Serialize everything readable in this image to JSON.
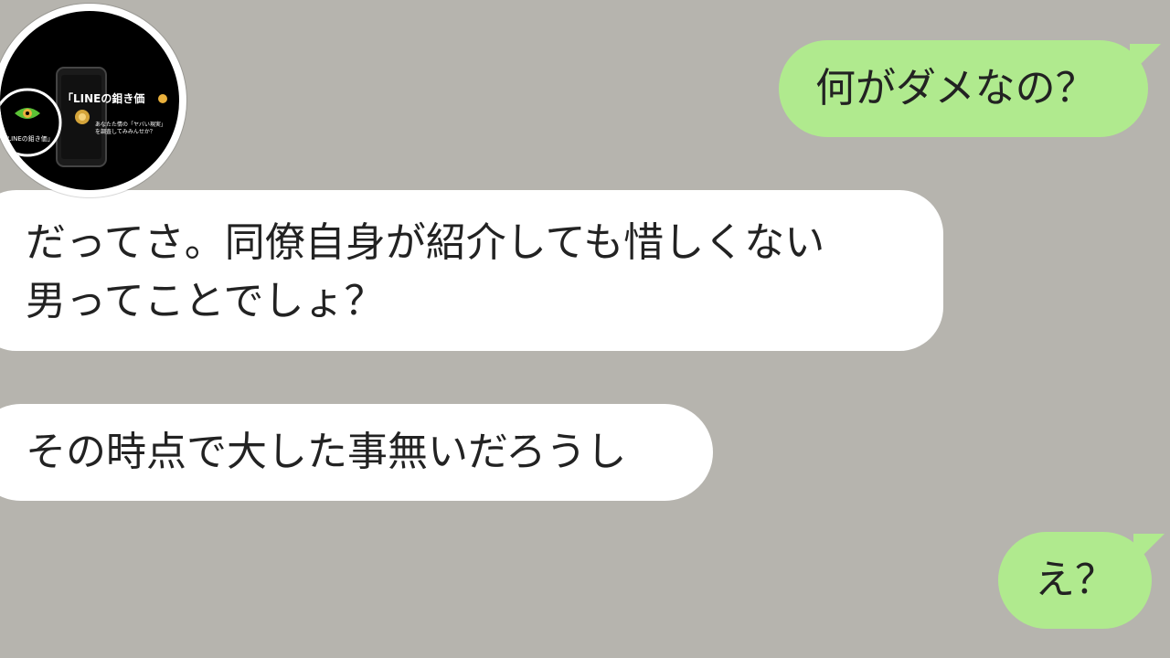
{
  "messages": [
    {
      "side": "right",
      "lines": [
        "何がダメなの？"
      ]
    },
    {
      "side": "left",
      "lines": [
        "だってさ。同僚自身が紹介しても惜しくない",
        "男ってことでしょ？"
      ]
    },
    {
      "side": "left",
      "lines": [
        "その時点で大した事無いだろうし"
      ]
    },
    {
      "side": "right",
      "lines": [
        "え？"
      ]
    }
  ],
  "logo": {
    "title": "「LINEの鉬き価",
    "small_label": "「LINEの鉬き価」",
    "tagline_line1": "あなたた情の「ヤバい現実」",
    "tagline_line2": "を調査してみみんせか？"
  },
  "colors": {
    "background": "#b6b4ae",
    "sent_bubble": "#b0ea8e",
    "received_bubble": "#ffffff"
  }
}
